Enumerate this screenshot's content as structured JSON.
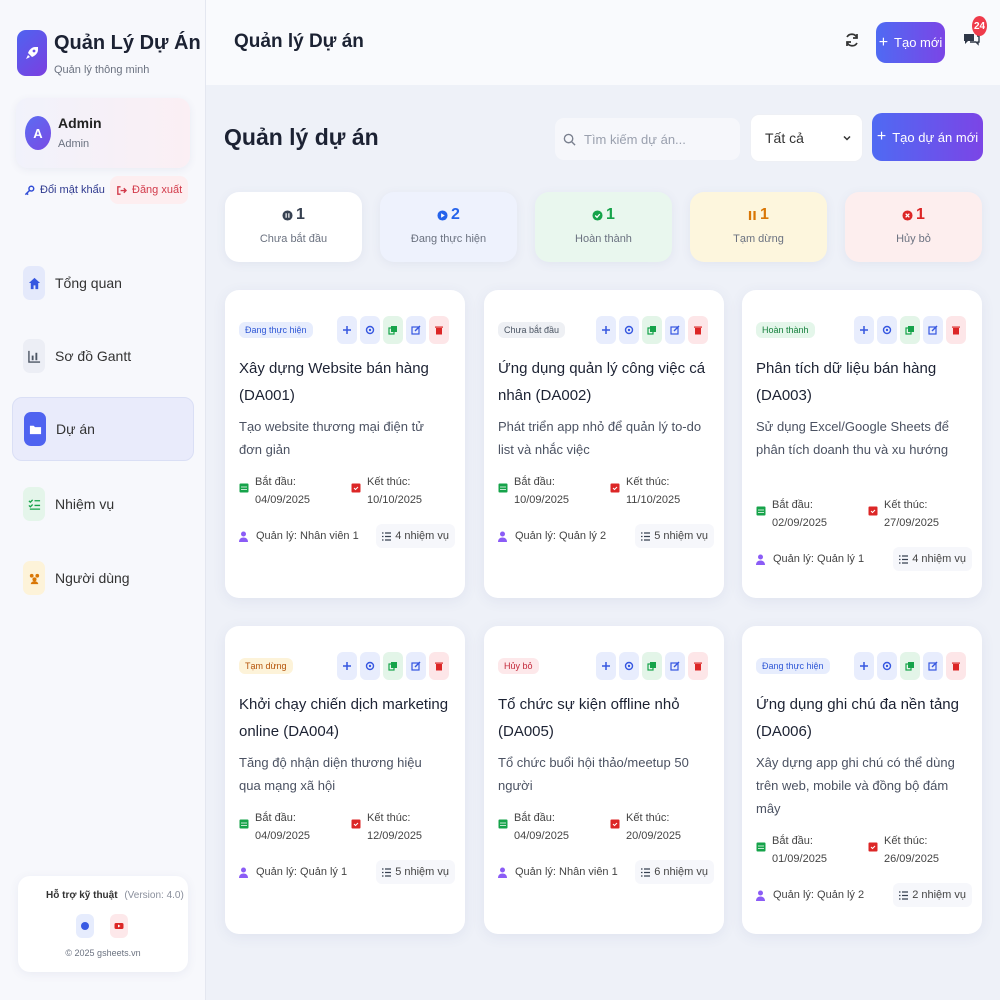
{
  "app": {
    "title": "Quản Lý Dự Án",
    "subtitle": "Quản lý thông minh"
  },
  "user": {
    "initial": "A",
    "name": "Admin",
    "role": "Admin"
  },
  "account": {
    "change_password": "Đổi mật khẩu",
    "logout": "Đăng xuất"
  },
  "nav": [
    {
      "label": "Tổng quan",
      "icon": "home-icon"
    },
    {
      "label": "Sơ đồ Gantt",
      "icon": "chart-icon"
    },
    {
      "label": "Dự án",
      "icon": "folder-icon"
    },
    {
      "label": "Nhiệm vụ",
      "icon": "checklist-icon"
    },
    {
      "label": "Người dùng",
      "icon": "users-icon"
    }
  ],
  "support": {
    "title": "Hỗ trợ kỹ thuật",
    "version": "(Version: 4.0)",
    "copyright": "© 2025 gsheets.vn"
  },
  "header": {
    "title": "Quản lý Dự án",
    "create_label": "Tạo mới",
    "notif_count": "24"
  },
  "main": {
    "title": "Quản lý dự án",
    "search_placeholder": "Tìm kiếm dự án...",
    "filter_value": "Tất cả",
    "create_project": "Tạo dự án mới"
  },
  "stats": [
    {
      "count": "1",
      "label": "Chưa bắt đầu",
      "color": "#374151"
    },
    {
      "count": "2",
      "label": "Đang thực hiện",
      "color": "#2563eb"
    },
    {
      "count": "1",
      "label": "Hoàn thành",
      "color": "#16a34a"
    },
    {
      "count": "1",
      "label": "Tạm dừng",
      "color": "#d97706"
    },
    {
      "count": "1",
      "label": "Hủy bỏ",
      "color": "#dc2626"
    }
  ],
  "labels": {
    "start": "Bắt đầu:",
    "end": "Kết thúc:"
  },
  "projects": [
    {
      "status": "Đang thực hiện",
      "title": "Xây dựng Website bán hàng (DA001)",
      "desc": "Tạo website thương mại điện tử đơn giản",
      "start": "04/09/2025",
      "end": "10/10/2025",
      "manager": "Quản lý: Nhân viên 1",
      "tasks": "4 nhiệm vụ"
    },
    {
      "status": "Chưa bắt đầu",
      "title": "Ứng dụng quản lý công việc cá nhân (DA002)",
      "desc": "Phát triển app nhỏ để quản lý to-do list và nhắc việc",
      "start": "10/09/2025",
      "end": "11/10/2025",
      "manager": "Quản lý: Quản lý 2",
      "tasks": "5 nhiệm vụ"
    },
    {
      "status": "Hoàn thành",
      "title": "Phân tích dữ liệu bán hàng (DA003)",
      "desc": "Sử dụng Excel/Google Sheets để phân tích doanh thu và xu hướng",
      "start": "02/09/2025",
      "end": "27/09/2025",
      "manager": "Quản lý: Quản lý 1",
      "tasks": "4 nhiệm vụ"
    },
    {
      "status": "Tạm dừng",
      "title": "Khởi chạy chiến dịch marketing online (DA004)",
      "desc": "Tăng độ nhận diện thương hiệu qua mạng xã hội",
      "start": "04/09/2025",
      "end": "12/09/2025",
      "manager": "Quản lý: Quản lý 1",
      "tasks": "5 nhiệm vụ"
    },
    {
      "status": "Hủy bỏ",
      "title": "Tổ chức sự kiện offline nhỏ (DA005)",
      "desc": "Tổ chức buổi hội thảo/meetup 50 người",
      "start": "04/09/2025",
      "end": "20/09/2025",
      "manager": "Quản lý: Nhân viên 1",
      "tasks": "6 nhiệm vụ"
    },
    {
      "status": "Đang thực hiện",
      "title": "Ứng dụng ghi chú đa nền tảng (DA006)",
      "desc": "Xây dựng app ghi chú có thể dùng trên web, mobile và đồng bộ đám mây",
      "start": "01/09/2025",
      "end": "26/09/2025",
      "manager": "Quản lý: Quản lý 2",
      "tasks": "2 nhiệm vụ"
    }
  ]
}
